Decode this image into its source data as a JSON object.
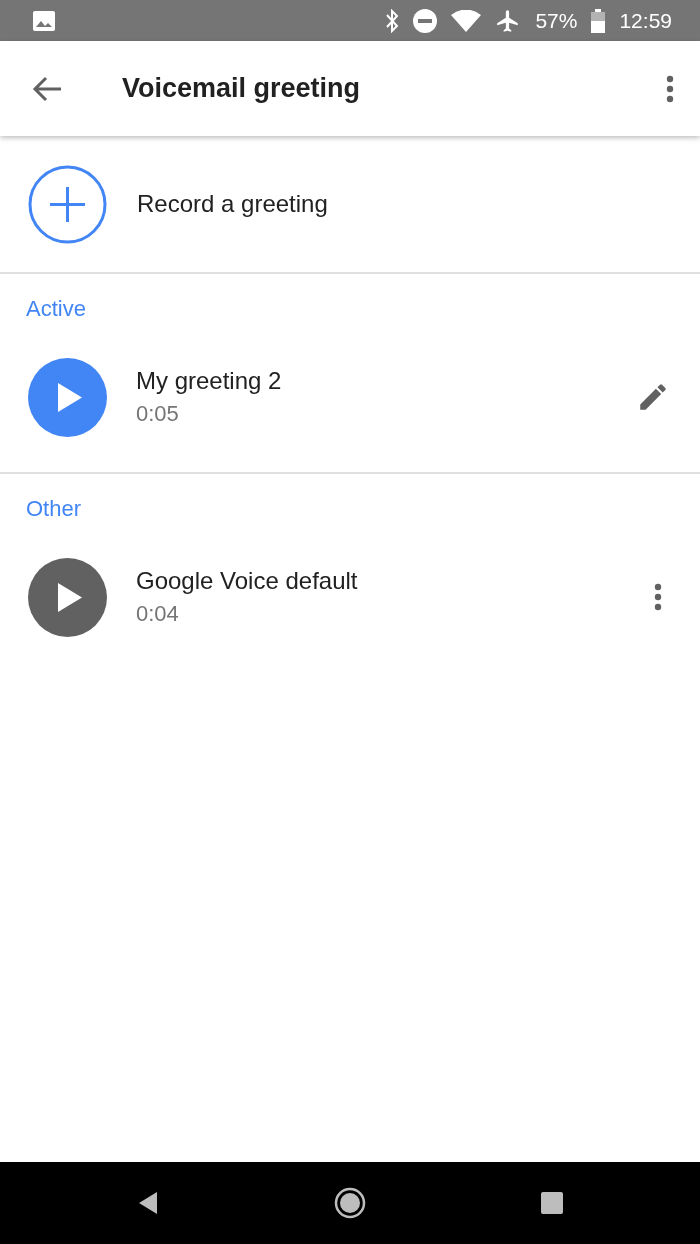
{
  "status_bar": {
    "battery": "57%",
    "time": "12:59"
  },
  "app_bar": {
    "title": "Voicemail greeting"
  },
  "record": {
    "label": "Record a greeting"
  },
  "sections": [
    {
      "header": "Active",
      "items": [
        {
          "title": "My greeting 2",
          "duration": "0:05",
          "active": true,
          "kind": "editable"
        }
      ]
    },
    {
      "header": "Other",
      "items": [
        {
          "title": "Google Voice default",
          "duration": "0:04",
          "active": false,
          "kind": "fixed"
        }
      ]
    }
  ]
}
